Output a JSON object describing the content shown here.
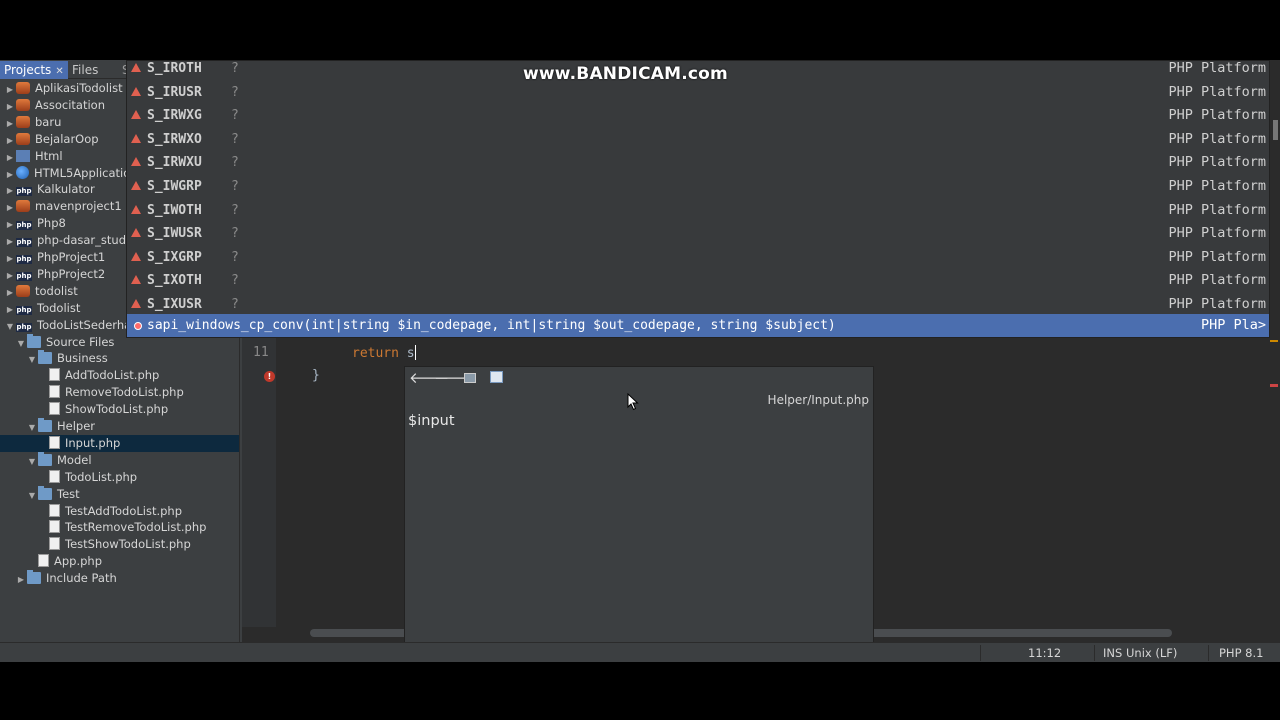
{
  "watermark": "www.BANDICAM.com",
  "panel_tabs": [
    {
      "label": "Projects",
      "active": true
    },
    {
      "label": "Files",
      "active": false
    },
    {
      "label": "S",
      "active": false
    }
  ],
  "tree": [
    {
      "label": "AplikasiTodolist",
      "icon": "project-icon",
      "expanded": false
    },
    {
      "label": "Associtation",
      "icon": "project-icon",
      "expanded": false
    },
    {
      "label": "baru",
      "icon": "project-icon",
      "expanded": false
    },
    {
      "label": "BejalarOop",
      "icon": "project-icon",
      "expanded": false
    },
    {
      "label": "Html",
      "icon": "html-project-icon",
      "expanded": false
    },
    {
      "label": "HTML5Applicatio",
      "icon": "globe-icon",
      "expanded": false
    },
    {
      "label": "Kalkulator",
      "icon": "php-project-icon",
      "expanded": false
    },
    {
      "label": "mavenproject1",
      "icon": "project-icon",
      "expanded": false
    },
    {
      "label": "Php8",
      "icon": "php-project-icon",
      "expanded": false
    },
    {
      "label": "php-dasar_studi",
      "icon": "php-project-icon",
      "expanded": false
    },
    {
      "label": "PhpProject1",
      "icon": "php-project-icon",
      "expanded": false
    },
    {
      "label": "PhpProject2",
      "icon": "php-project-icon",
      "expanded": false
    },
    {
      "label": "todolist",
      "icon": "project-icon",
      "expanded": false
    },
    {
      "label": "Todolist",
      "icon": "php-project-icon",
      "expanded": false
    },
    {
      "label": "TodoListSederha",
      "icon": "php-project-icon",
      "expanded": true
    },
    {
      "label": "Source Files",
      "icon": "folder-icon",
      "expanded": true
    },
    {
      "label": "Business",
      "icon": "folder-icon",
      "expanded": true
    },
    {
      "label": "AddTodoList.php",
      "icon": "php-file-icon"
    },
    {
      "label": "RemoveTodoList.php",
      "icon": "php-file-icon"
    },
    {
      "label": "ShowTodoList.php",
      "icon": "php-file-icon"
    },
    {
      "label": "Helper",
      "icon": "folder-icon",
      "expanded": true
    },
    {
      "label": "Input.php",
      "icon": "php-file-icon",
      "selected": true
    },
    {
      "label": "Model",
      "icon": "folder-icon",
      "expanded": true
    },
    {
      "label": "TodoList.php",
      "icon": "php-file-icon"
    },
    {
      "label": "Test",
      "icon": "folder-icon",
      "expanded": true
    },
    {
      "label": "TestAddTodoList.php",
      "icon": "php-file-icon"
    },
    {
      "label": "TestRemoveTodoList.php",
      "icon": "php-file-icon"
    },
    {
      "label": "TestShowTodoList.php",
      "icon": "php-file-icon"
    },
    {
      "label": "App.php",
      "icon": "php-file-icon"
    },
    {
      "label": "Include Path",
      "icon": "folder-icon",
      "expanded": false
    }
  ],
  "completion": {
    "items": [
      {
        "name": "S_IROTH",
        "type": "?",
        "source": "PHP Platform"
      },
      {
        "name": "S_IRUSR",
        "type": "?",
        "source": "PHP Platform"
      },
      {
        "name": "S_IRWXG",
        "type": "?",
        "source": "PHP Platform"
      },
      {
        "name": "S_IRWXO",
        "type": "?",
        "source": "PHP Platform"
      },
      {
        "name": "S_IRWXU",
        "type": "?",
        "source": "PHP Platform"
      },
      {
        "name": "S_IWGRP",
        "type": "?",
        "source": "PHP Platform"
      },
      {
        "name": "S_IWOTH",
        "type": "?",
        "source": "PHP Platform"
      },
      {
        "name": "S_IWUSR",
        "type": "?",
        "source": "PHP Platform"
      },
      {
        "name": "S_IXGRP",
        "type": "?",
        "source": "PHP Platform"
      },
      {
        "name": "S_IXOTH",
        "type": "?",
        "source": "PHP Platform"
      },
      {
        "name": "S_IXUSR",
        "type": "?",
        "source": "PHP Platform"
      }
    ],
    "selected": {
      "signature": "sapi_windows_cp_conv(int|string $in_codepage, int|string $out_codepage, string $subject)",
      "source": "PHP Pla>"
    }
  },
  "editor": {
    "line_number": "11",
    "keyword": "return",
    "typed": "s",
    "closing_brace": "}"
  },
  "doc": {
    "path": "Helper/Input.php",
    "name": "$input"
  },
  "status": {
    "position": "11:12",
    "mode": "INS",
    "line_ending": "Unix (LF)",
    "php_version": "PHP 8.1"
  }
}
